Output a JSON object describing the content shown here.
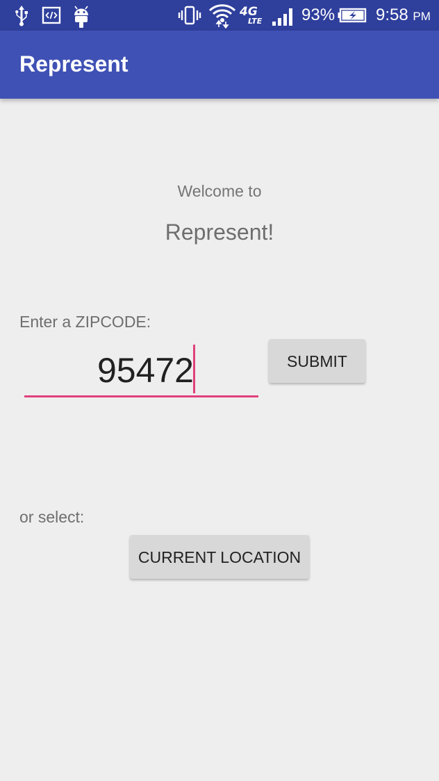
{
  "status_bar": {
    "battery_percent": "93%",
    "time": "9:58",
    "time_suffix": "PM",
    "network_top": "4G",
    "network_bottom": "LTE",
    "icons": [
      "usb-icon",
      "developer-code-icon",
      "android-icon",
      "vibrate-icon",
      "wifi-icon",
      "lte-icon",
      "signal-icon",
      "battery-charging-icon"
    ]
  },
  "app_bar": {
    "title": "Represent"
  },
  "main": {
    "welcome_line": "Welcome to",
    "welcome_title": "Represent!",
    "zip_label": "Enter a ZIPCODE:",
    "zip_value": "95472",
    "submit_label": "SUBMIT",
    "or_select_label": "or select:",
    "current_location_label": "CURRENT LOCATION"
  },
  "colors": {
    "status_bar": "#2f3f9c",
    "app_bar": "#3f51b5",
    "background": "#eeeeee",
    "accent": "#e0407b",
    "button": "#d8d8d8"
  }
}
